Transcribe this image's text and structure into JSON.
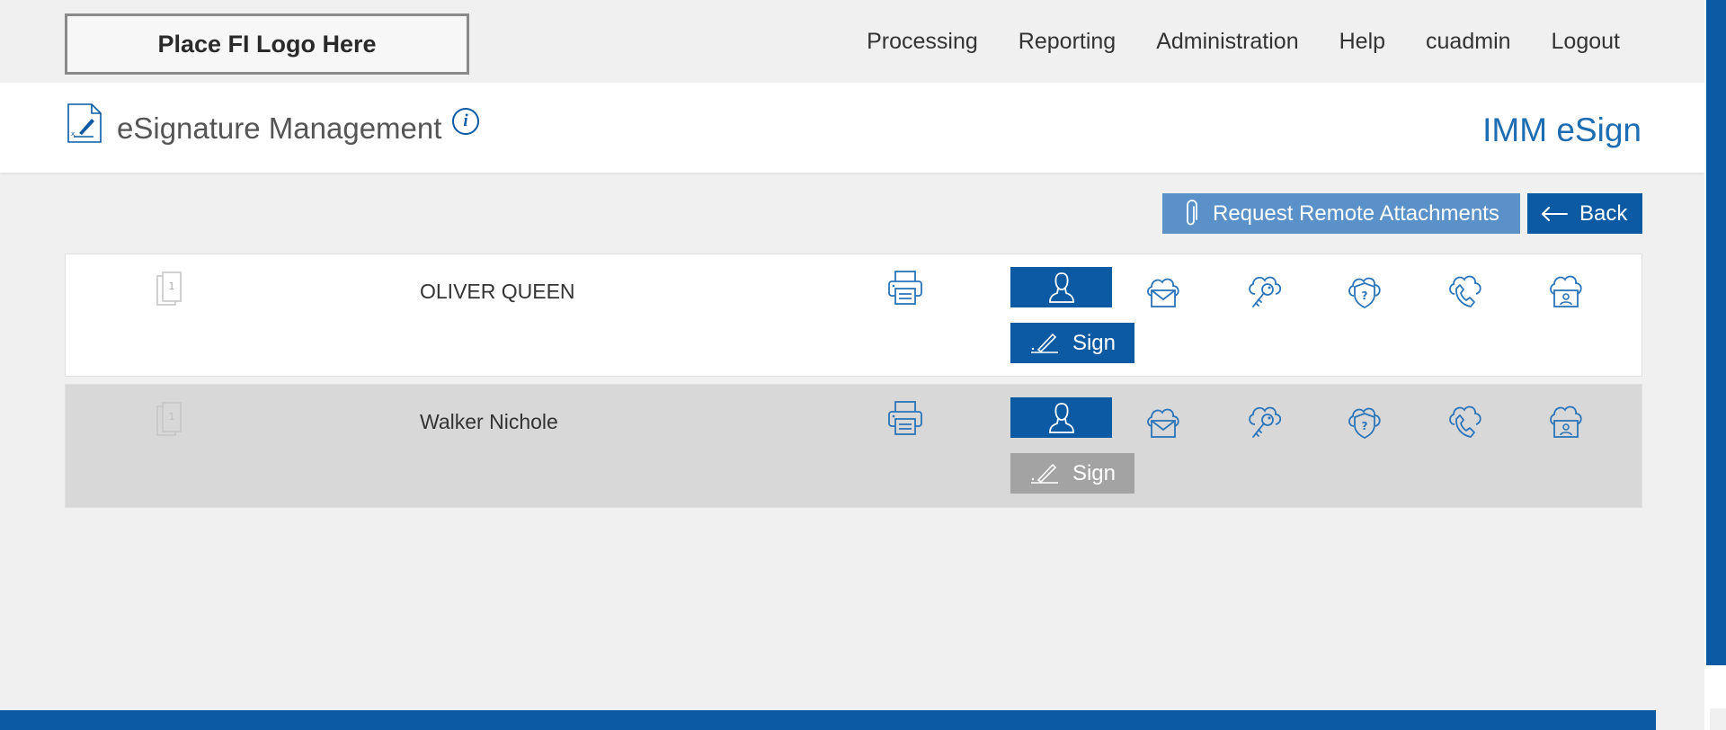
{
  "header": {
    "logo_text": "Place FI Logo Here",
    "nav": [
      "Processing",
      "Reporting",
      "Administration",
      "Help",
      "cuadmin",
      "Logout"
    ]
  },
  "titlebar": {
    "title": "eSignature Management",
    "info_glyph": "i",
    "app_name": "IMM eSign"
  },
  "actions": {
    "request_attachments": "Request Remote Attachments",
    "back": "Back"
  },
  "signers": [
    {
      "name": "OLIVER QUEEN",
      "page_number": "1",
      "sign_label": "Sign",
      "sign_enabled": true
    },
    {
      "name": "Walker Nichole",
      "page_number": "1",
      "sign_label": "Sign",
      "sign_enabled": false
    }
  ],
  "auth_icons": [
    "cloud-email-icon",
    "cloud-key-icon",
    "cloud-shield-question-icon",
    "cloud-phone-icon",
    "cloud-id-card-icon"
  ],
  "colors": {
    "primary": "#0b5aa3",
    "primary_light": "#5a91c8",
    "disabled": "#a3a3a3",
    "row_alt": "#d8d8d8"
  }
}
